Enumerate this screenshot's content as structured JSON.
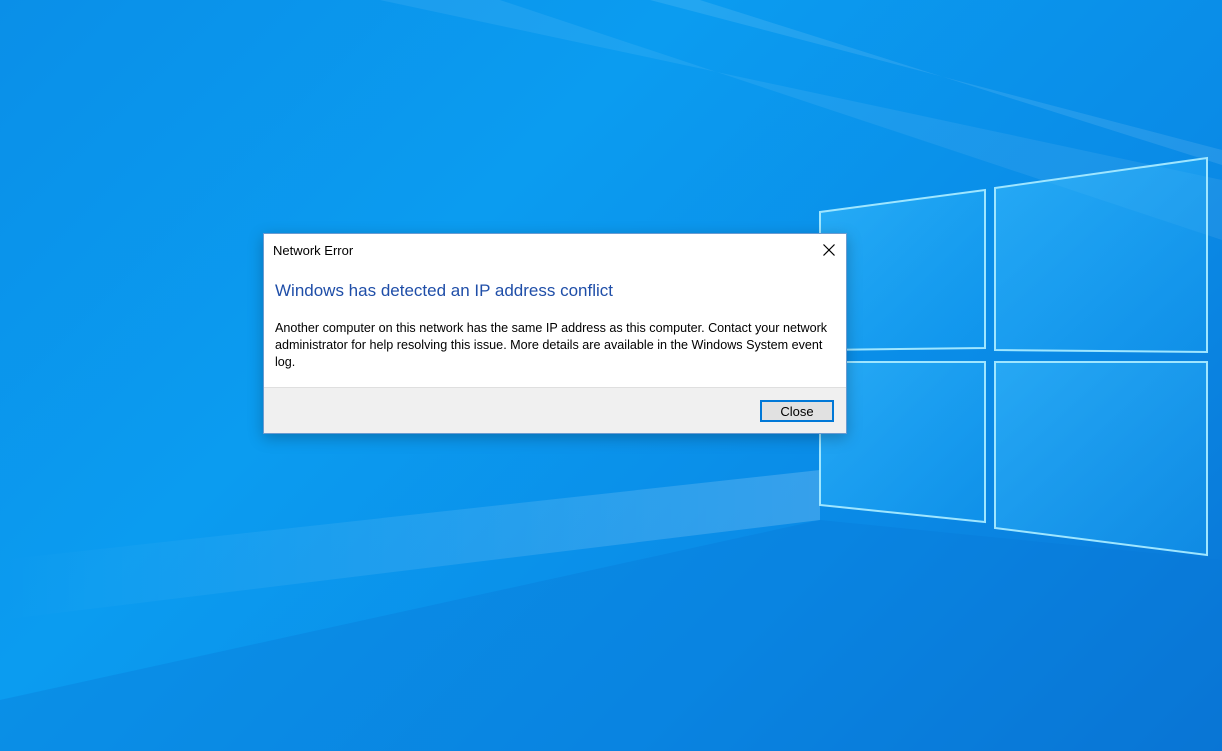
{
  "desktop": {
    "wallpaper": "windows-logo-wallpaper",
    "accent_color": "#0a8fe8"
  },
  "dialog": {
    "title": "Network Error",
    "close_icon": "close-icon",
    "heading": "Windows has detected an IP address conflict",
    "message": "Another computer on this network has the same IP address as this computer. Contact your network administrator for help resolving this issue. More details are available in the Windows System event log.",
    "close_button_label": "Close",
    "heading_color": "#1f4ea8",
    "button_focus_color": "#0078d7"
  }
}
